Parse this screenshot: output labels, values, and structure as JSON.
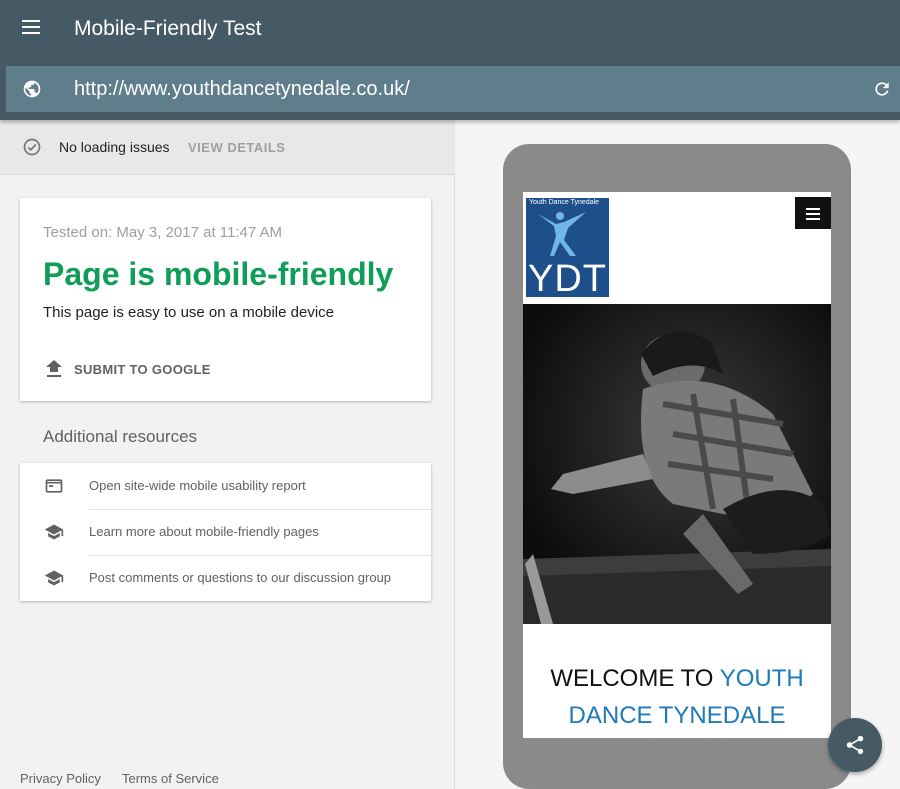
{
  "header": {
    "title": "Mobile-Friendly Test",
    "url": "http://www.youthdancetynedale.co.uk/"
  },
  "status": {
    "text": "No loading issues",
    "details_label": "VIEW DETAILS"
  },
  "result": {
    "tested_on": "Tested on: May 3, 2017 at 11:47 AM",
    "title": "Page is mobile-friendly",
    "subtitle": "This page is easy to use on a mobile device",
    "submit_label": "SUBMIT TO GOOGLE"
  },
  "resources": {
    "heading": "Additional resources",
    "items": [
      {
        "label": "Open site-wide mobile usability report",
        "icon": "browser-window-icon"
      },
      {
        "label": "Learn more about mobile-friendly pages",
        "icon": "school-icon"
      },
      {
        "label": "Post comments or questions to our discussion group",
        "icon": "school-icon"
      }
    ]
  },
  "footer": {
    "privacy": "Privacy Policy",
    "terms": "Terms of Service"
  },
  "preview": {
    "logo_name": "Youth Dance Tynedale",
    "logo_letters": "YDT",
    "welcome_part1": "WELCOME TO ",
    "welcome_part2": "YOUTH DANCE TYNEDALE"
  },
  "colors": {
    "topbar": "#455a64",
    "urlbar": "#607d8b",
    "success": "#0f9d58",
    "site_blue": "#1e7ab8"
  }
}
